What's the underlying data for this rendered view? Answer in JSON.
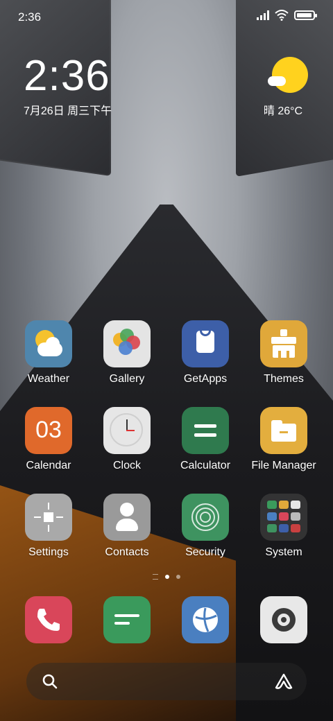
{
  "status": {
    "time": "2:36",
    "battery_level": 0.95
  },
  "clock_widget": {
    "time": "2:36",
    "date": "7月26日 周三下午"
  },
  "weather_widget": {
    "text": "晴 26°C"
  },
  "apps": [
    {
      "label": "Weather",
      "icon": "weather-icon"
    },
    {
      "label": "Gallery",
      "icon": "gallery-icon"
    },
    {
      "label": "GetApps",
      "icon": "getapps-icon"
    },
    {
      "label": "Themes",
      "icon": "themes-icon"
    },
    {
      "label": "Calendar",
      "icon": "calendar-icon",
      "icon_text": "03"
    },
    {
      "label": "Clock",
      "icon": "clock-icon"
    },
    {
      "label": "Calculator",
      "icon": "calculator-icon"
    },
    {
      "label": "File Manager",
      "icon": "file-manager-icon"
    },
    {
      "label": "Settings",
      "icon": "settings-icon"
    },
    {
      "label": "Contacts",
      "icon": "contacts-icon"
    },
    {
      "label": "Security",
      "icon": "security-icon"
    },
    {
      "label": "System",
      "icon": "system-folder-icon"
    }
  ],
  "dock": [
    {
      "icon": "phone-icon"
    },
    {
      "icon": "messages-icon"
    },
    {
      "icon": "browser-icon"
    },
    {
      "icon": "camera-icon"
    }
  ],
  "pager": {
    "pages": 2,
    "current": 1
  },
  "colors": {
    "weather": "#4f86ad",
    "gallery": "#e4e4e4",
    "getapps": "#3d5fa8",
    "themes": "#e0a83a",
    "calendar": "#e0692b",
    "clock": "#e6e6e6",
    "calculator": "#2f7a4e",
    "filemanager": "#e3ae3e",
    "settings": "#a9a9a9",
    "contacts": "#9a9a9a",
    "security": "#3e9360",
    "phone": "#d9465a",
    "messages": "#3a9a5c",
    "browser": "#4a7fc0",
    "camera": "#e8e8e8"
  }
}
